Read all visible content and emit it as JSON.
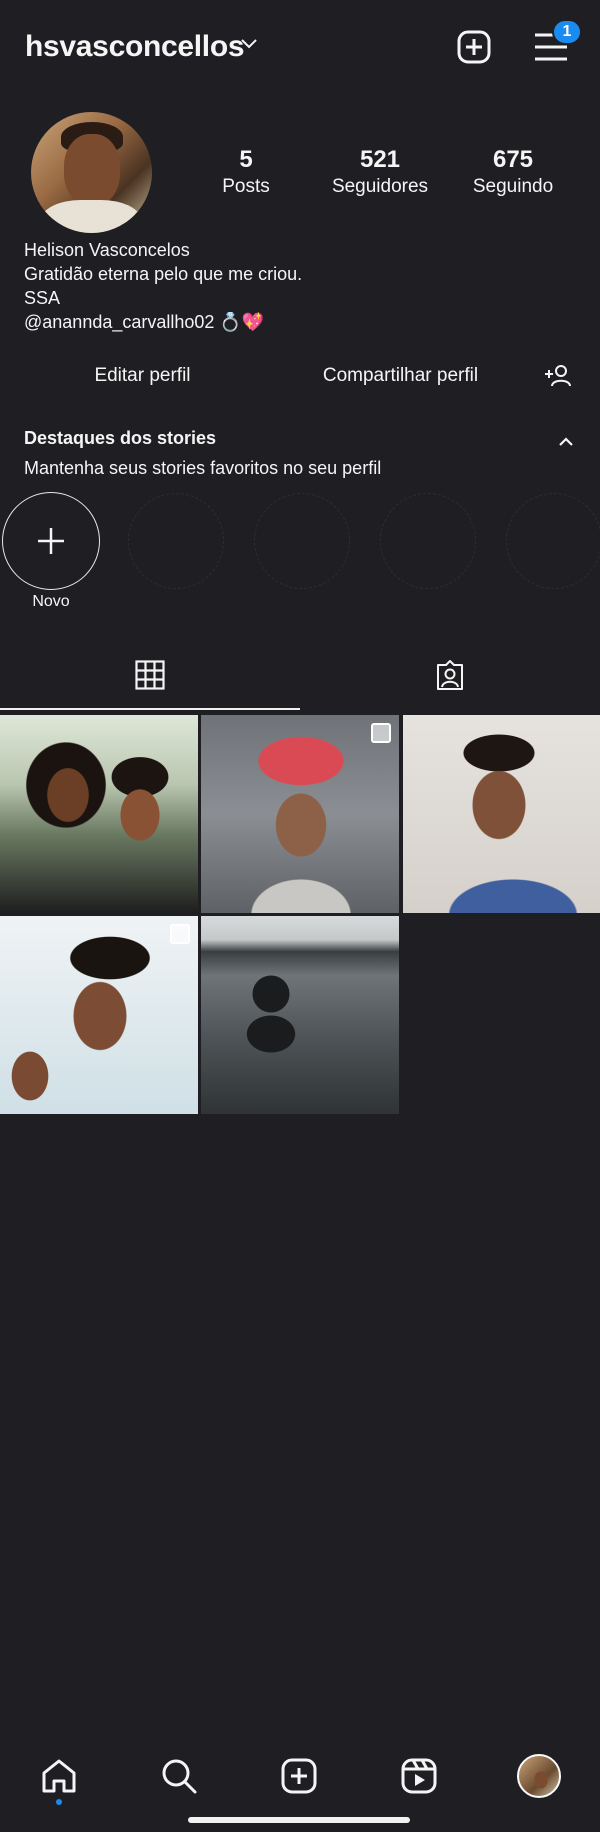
{
  "header": {
    "username": "hsvasconcellos",
    "notification_count": "1"
  },
  "profile": {
    "stats": [
      {
        "value": "5",
        "label": "Posts"
      },
      {
        "value": "521",
        "label": "Seguidores"
      },
      {
        "value": "675",
        "label": "Seguindo"
      }
    ],
    "bio": {
      "name": "Helison Vasconcelos",
      "line1": "Gratidão eterna pelo que me criou.",
      "line2": "SSA",
      "line3": "@anannda_carvallho02 💍💖"
    },
    "buttons": {
      "edit": "Editar perfil",
      "share": "Compartilhar perfil"
    }
  },
  "highlights": {
    "title": "Destaques dos stories",
    "subtitle": "Mantenha seus stories favoritos no seu perfil",
    "new_label": "Novo"
  },
  "tabs": [
    {
      "icon": "grid-icon",
      "active": true
    },
    {
      "icon": "tagged-icon",
      "active": false
    }
  ],
  "posts": [
    {
      "icon": "photo",
      "multi": false
    },
    {
      "icon": "photo",
      "multi": true
    },
    {
      "icon": "photo",
      "multi": false
    },
    {
      "icon": "photo",
      "multi": true
    },
    {
      "icon": "photo",
      "multi": false
    }
  ],
  "bottom_nav": [
    {
      "icon": "home-icon",
      "active": true
    },
    {
      "icon": "search-icon",
      "active": false
    },
    {
      "icon": "create-icon",
      "active": false
    },
    {
      "icon": "reels-icon",
      "active": false
    },
    {
      "icon": "profile-avatar",
      "active": false
    }
  ],
  "colors": {
    "background": "#1f1f23",
    "accent": "#1a8cf0",
    "text": "#f5f5f5"
  }
}
